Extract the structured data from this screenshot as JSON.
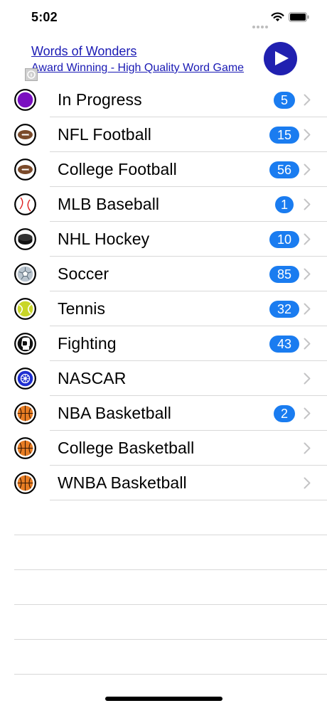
{
  "status": {
    "time": "5:02"
  },
  "ad": {
    "title": "Words of Wonders",
    "subtitle": "Award Winning - High Quality Word Game"
  },
  "sports": [
    {
      "label": "In Progress",
      "badge": "5",
      "icon": "in-progress-icon"
    },
    {
      "label": "NFL Football",
      "badge": "15",
      "icon": "football-icon"
    },
    {
      "label": "College Football",
      "badge": "56",
      "icon": "football-icon"
    },
    {
      "label": "MLB Baseball",
      "badge": "1",
      "icon": "baseball-icon"
    },
    {
      "label": "NHL Hockey",
      "badge": "10",
      "icon": "hockey-puck-icon"
    },
    {
      "label": "Soccer",
      "badge": "85",
      "icon": "soccer-ball-icon"
    },
    {
      "label": "Tennis",
      "badge": "32",
      "icon": "tennis-ball-icon"
    },
    {
      "label": "Fighting",
      "badge": "43",
      "icon": "boxing-glove-icon"
    },
    {
      "label": "NASCAR",
      "badge": "",
      "icon": "nascar-wheel-icon"
    },
    {
      "label": "NBA Basketball",
      "badge": "2",
      "icon": "basketball-icon"
    },
    {
      "label": "College Basketball",
      "badge": "",
      "icon": "basketball-icon"
    },
    {
      "label": "WNBA Basketball",
      "badge": "",
      "icon": "basketball-icon"
    }
  ],
  "colors": {
    "badge": "#1a7cf0",
    "ad_link": "#1a1ab4",
    "ad_play": "#2020b0",
    "in_progress": "#7a0fc0"
  }
}
